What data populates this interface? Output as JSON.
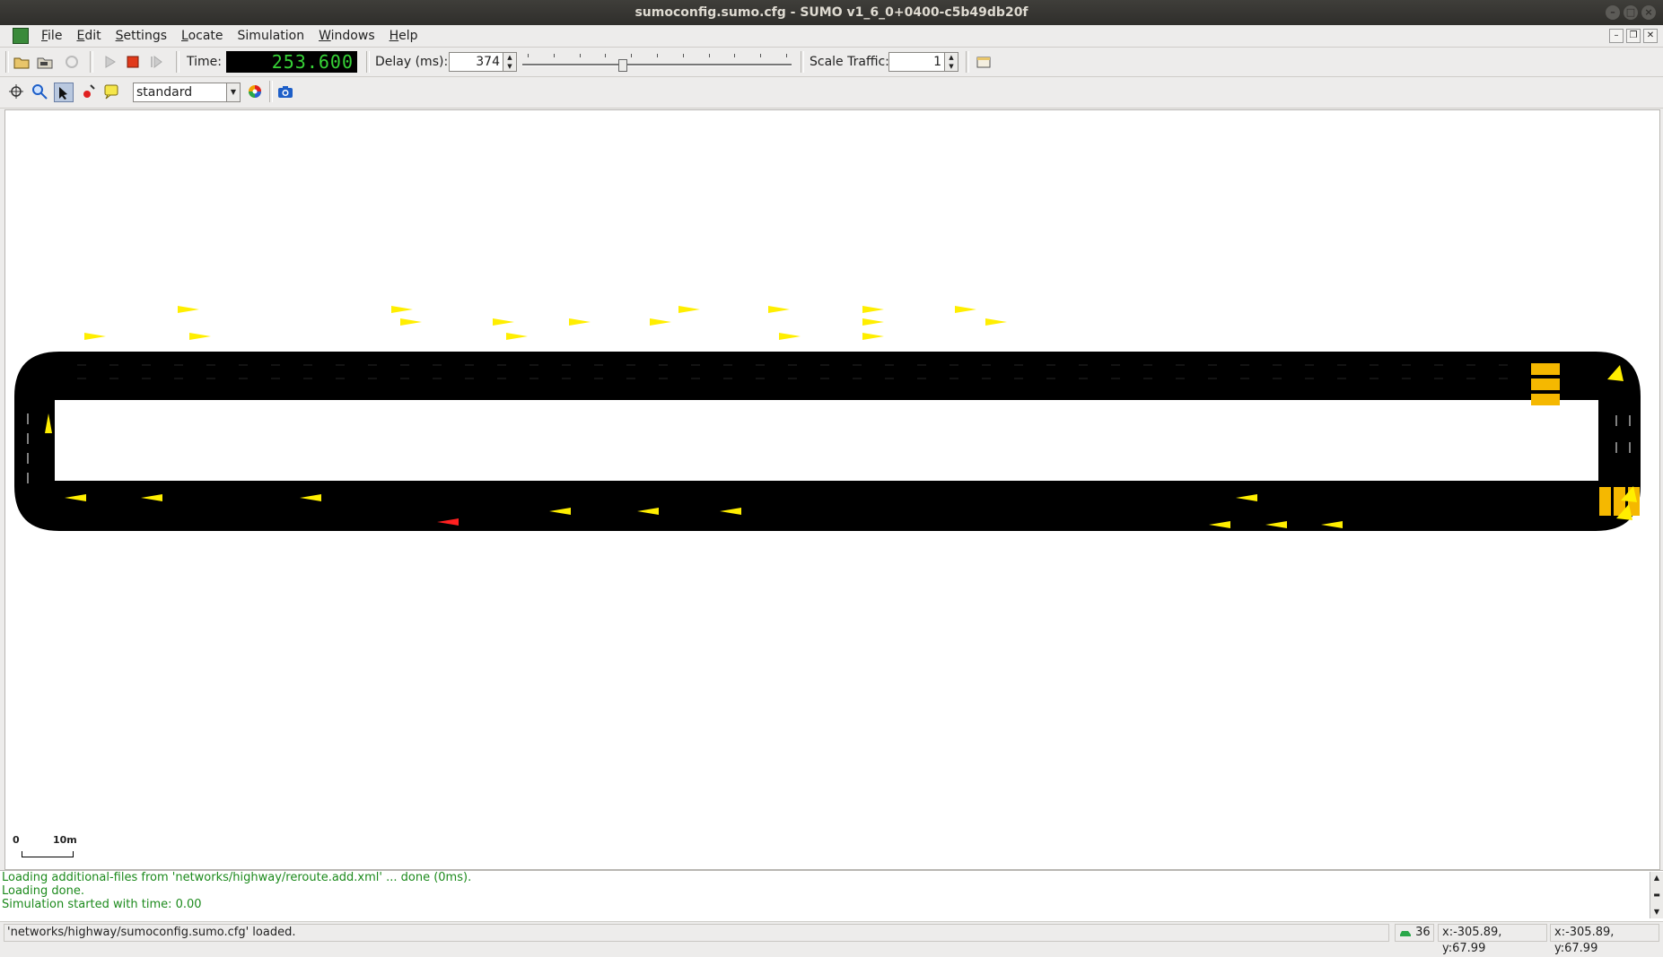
{
  "window": {
    "title": "sumoconfig.sumo.cfg - SUMO v1_6_0+0400-c5b49db20f"
  },
  "menu": [
    {
      "mnemonic": "F",
      "rest": "ile"
    },
    {
      "mnemonic": "E",
      "rest": "dit"
    },
    {
      "mnemonic": "S",
      "rest": "ettings"
    },
    {
      "mnemonic": "L",
      "rest": "ocate"
    },
    {
      "mnemonic": "",
      "rest": "Simulation"
    },
    {
      "mnemonic": "W",
      "rest": "indows"
    },
    {
      "mnemonic": "H",
      "rest": "elp"
    }
  ],
  "toolbar": {
    "time_label": "Time:",
    "time_value": "253.600",
    "delay_label": "Delay (ms):",
    "delay_value": "374",
    "delay_slider_fraction": 0.37,
    "scale_label": "Scale Traffic:",
    "scale_value": "1"
  },
  "view": {
    "scheme": "standard",
    "scale_zero": "0",
    "scale_length": "10m"
  },
  "log": [
    "Loading additional-files from 'networks/highway/reroute.add.xml' ... done (0ms).",
    "Loading done.",
    "Simulation started with time: 0.00"
  ],
  "status": {
    "message": "'networks/highway/sumoconfig.sumo.cfg' loaded.",
    "vehicle_count": "36",
    "coords_1": "x:-305.89, y:67.99",
    "coords_2": "x:-305.89, y:67.99"
  },
  "colors": {
    "road": "#000000",
    "vehicle": "#ffee00",
    "vehicle_alt": "#ff2020",
    "log_text": "#1c8a1c",
    "time_digits": "#37d337"
  }
}
